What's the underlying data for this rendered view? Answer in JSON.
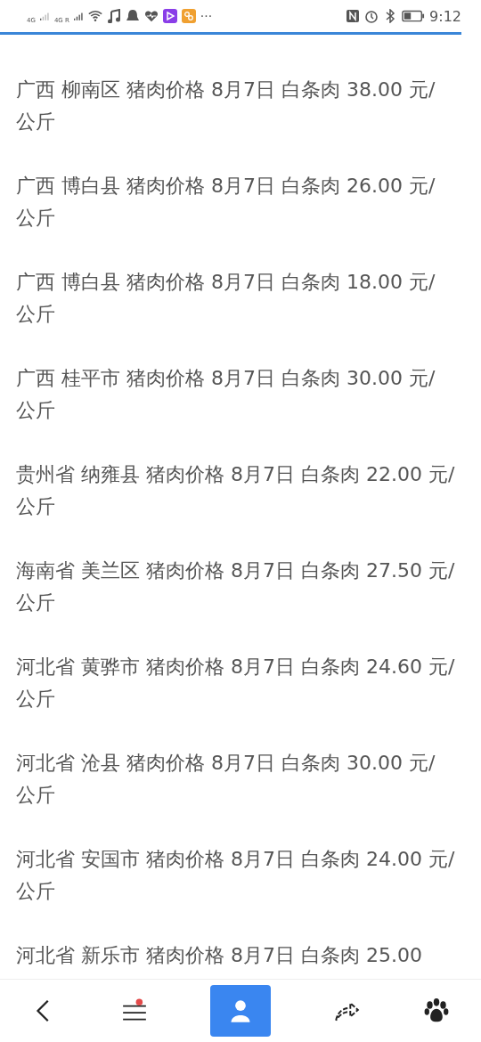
{
  "status_bar": {
    "network_1": "4G",
    "network_2": "4G R",
    "more": "···",
    "time": "9:12"
  },
  "items": [
    {
      "text": "广西 柳南区 猪肉价格 8月7日 白条肉 38.00 元/公斤"
    },
    {
      "text": "广西 博白县 猪肉价格 8月7日 白条肉 26.00 元/公斤"
    },
    {
      "text": "广西 博白县 猪肉价格 8月7日 白条肉 18.00 元/公斤"
    },
    {
      "text": "广西 桂平市 猪肉价格 8月7日 白条肉 30.00 元/公斤"
    },
    {
      "text": "贵州省 纳雍县 猪肉价格 8月7日 白条肉 22.00 元/公斤"
    },
    {
      "text": "海南省 美兰区 猪肉价格 8月7日 白条肉 27.50 元/公斤"
    },
    {
      "text": "河北省 黄骅市 猪肉价格 8月7日 白条肉 24.60 元/公斤"
    },
    {
      "text": "河北省 沧县 猪肉价格 8月7日 白条肉 30.00 元/公斤"
    },
    {
      "text": "河北省 安国市 猪肉价格 8月7日 白条肉 24.00 元/公斤"
    },
    {
      "text": "河北省 新乐市 猪肉价格 8月7日 白条肉 25.00"
    }
  ],
  "bottom_bar": {
    "menu_badge": true
  }
}
